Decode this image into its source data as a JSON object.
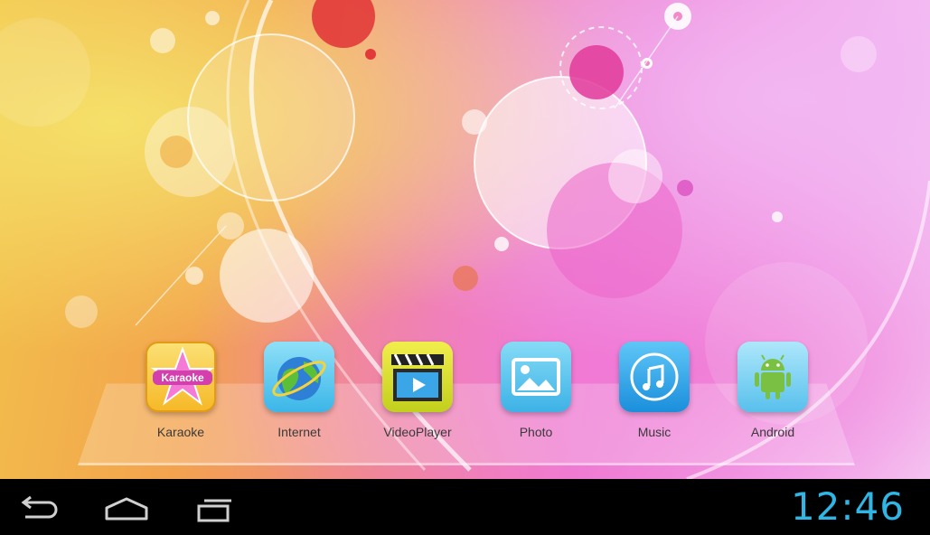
{
  "apps": [
    {
      "label": "Karaoke",
      "icon": "karaoke-icon",
      "badge_text": "Karaoke"
    },
    {
      "label": "Internet",
      "icon": "globe-icon"
    },
    {
      "label": "VideoPlayer",
      "icon": "clapperboard-icon"
    },
    {
      "label": "Photo",
      "icon": "picture-icon"
    },
    {
      "label": "Music",
      "icon": "music-note-icon"
    },
    {
      "label": "Android",
      "icon": "android-robot-icon"
    }
  ],
  "navbar": {
    "back_icon": "back-arrow-icon",
    "home_icon": "home-icon",
    "recents_icon": "recent-apps-icon",
    "clock": "12:46"
  },
  "colors": {
    "clock": "#2fb6e4",
    "navbar": "#000000",
    "label": "#3a3a3a"
  }
}
